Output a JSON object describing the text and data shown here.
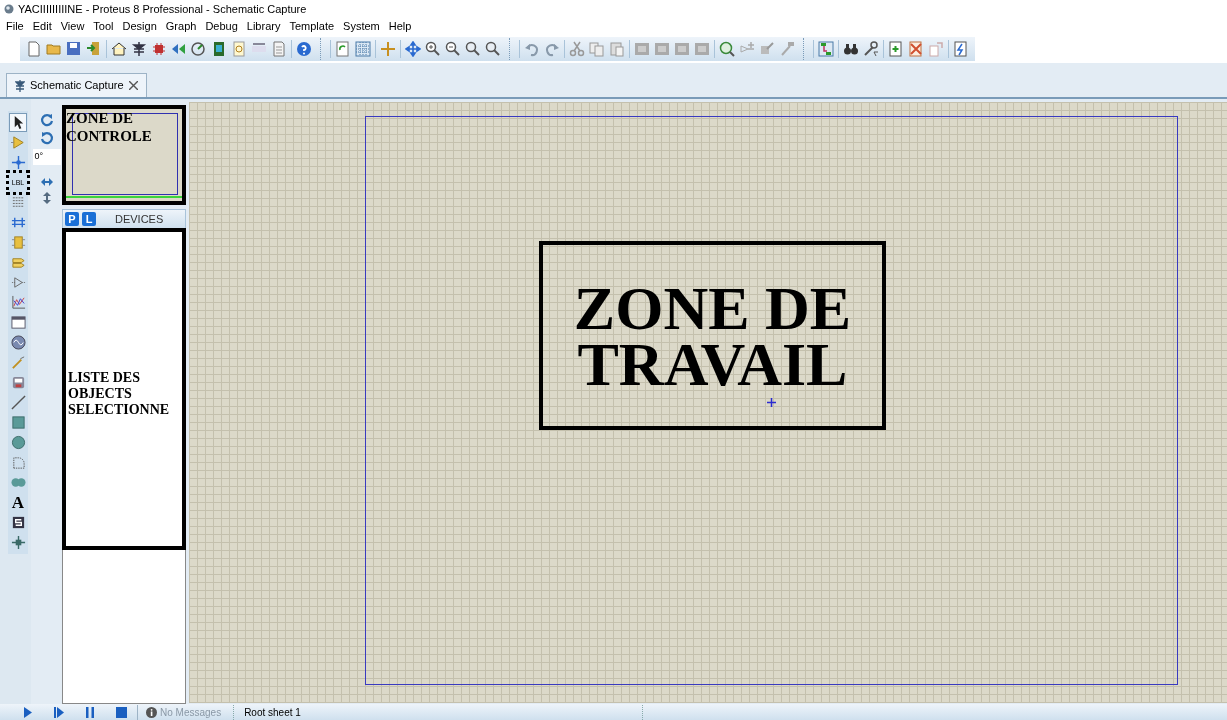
{
  "window": {
    "title": "YACIIIIIIIIINE - Proteus 8 Professional - Schematic Capture"
  },
  "menu": [
    "File",
    "Edit",
    "View",
    "Tool",
    "Design",
    "Graph",
    "Debug",
    "Library",
    "Template",
    "System",
    "Help"
  ],
  "tabs": [
    {
      "label": "Schematic Capture",
      "selected": true
    }
  ],
  "left_toolbar": [
    {
      "kind": "pointer",
      "selected": true
    },
    {
      "kind": "component",
      "selected": false
    },
    {
      "kind": "junction",
      "selected": false
    },
    {
      "kind": "label",
      "text": "LBL",
      "selected": false
    },
    {
      "kind": "script",
      "selected": false
    },
    {
      "kind": "bus",
      "selected": false
    },
    {
      "kind": "subcircuit",
      "selected": false
    },
    {
      "kind": "terminal",
      "selected": false
    },
    {
      "kind": "pin",
      "selected": false
    },
    {
      "kind": "graph",
      "selected": false
    },
    {
      "kind": "tape",
      "selected": false
    },
    {
      "kind": "generator",
      "selected": false
    },
    {
      "kind": "probe",
      "selected": false
    },
    {
      "kind": "instrument",
      "selected": false
    },
    {
      "kind": "line",
      "selected": false
    },
    {
      "kind": "box",
      "selected": false
    },
    {
      "kind": "circle",
      "selected": false
    },
    {
      "kind": "arc",
      "selected": false
    },
    {
      "kind": "path",
      "selected": false
    },
    {
      "kind": "text",
      "text": "A",
      "selected": false
    },
    {
      "kind": "symbol",
      "selected": false
    },
    {
      "kind": "marker",
      "selected": false
    }
  ],
  "rotation": {
    "value": "0°"
  },
  "object_selector": {
    "buttons": [
      "P",
      "L"
    ],
    "title": "DEVICES"
  },
  "annotations": {
    "control": "ZONE DE CONTROLE",
    "list": "LISTE DES OBJECTS SELECTIONNE",
    "work": "ZONE DE TRAVAIL"
  },
  "status_bar": {
    "messages": "No Messages",
    "sheet": "Root sheet 1"
  }
}
